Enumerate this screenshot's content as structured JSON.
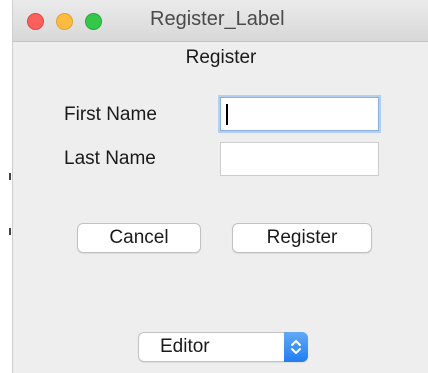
{
  "window": {
    "title": "Register_Label",
    "traffic_lights": {
      "close_color": "#fc605c",
      "minimize_color": "#fdbc40",
      "maximize_color": "#34c84a"
    }
  },
  "form": {
    "heading": "Register",
    "first_name_label": "First Name",
    "first_name_value": "",
    "last_name_label": "Last Name",
    "last_name_value": "",
    "cancel_label": "Cancel",
    "register_label": "Register"
  },
  "mode_select": {
    "selected": "Editor",
    "accent_color": "#1f7ef0"
  }
}
